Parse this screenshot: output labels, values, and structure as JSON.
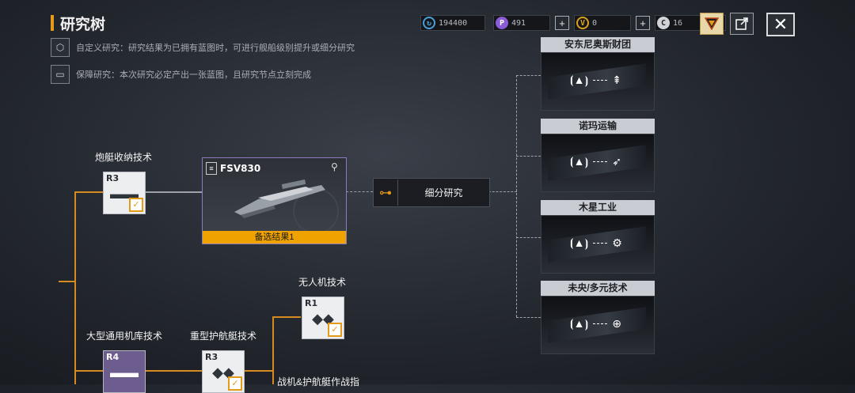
{
  "header": {
    "title": "研究树"
  },
  "info": [
    {
      "icon": "cube-icon",
      "text": "自定义研究：研究结果为已拥有蓝图时，可进行舰船级别提升或细分研究"
    },
    {
      "icon": "blueprint-icon",
      "text": "保障研究：本次研究必定产出一张蓝图，且研究节点立刻完成"
    }
  ],
  "resources": [
    {
      "name": "credits",
      "icon": "refresh-coin-icon",
      "value": "194400",
      "color": "#4a9fd8"
    },
    {
      "name": "purple-currency",
      "icon": "gem-icon",
      "value": "491",
      "color": "#8a5bd6"
    },
    {
      "name": "gold-currency",
      "icon": "v-coin-icon",
      "value": "0",
      "color": "#d9a21c"
    },
    {
      "name": "silver-currency",
      "icon": "c-coin-icon",
      "value": "16",
      "color": "#d0d3d8"
    }
  ],
  "tree": {
    "nodes": [
      {
        "id": "gunboat",
        "label": "炮艇收纳技术",
        "tier": "R3",
        "glyph": "hangar-icon"
      },
      {
        "id": "drone",
        "label": "无人机技术",
        "tier": "R1",
        "glyph": "drone-icon"
      },
      {
        "id": "carrier",
        "label": "大型通用机库技术",
        "tier": "R4",
        "glyph": "hangar-icon"
      },
      {
        "id": "escort",
        "label": "重型护航艇技术",
        "tier": "R3",
        "glyph": "drone-icon"
      },
      {
        "id": "fighter",
        "label": "战机&护航艇作战指"
      }
    ]
  },
  "ship_card": {
    "name": "FSV830",
    "result": "备选结果1"
  },
  "subdivision": {
    "label": "细分研究"
  },
  "corporations": [
    {
      "name": "安东尼奥斯财团",
      "icon": "sword-emblem-icon"
    },
    {
      "name": "诺玛运输",
      "icon": "wing-emblem-icon"
    },
    {
      "name": "木星工业",
      "icon": "gear-globe-icon"
    },
    {
      "name": "未央/多元技术",
      "icon": "globe-icon"
    }
  ]
}
